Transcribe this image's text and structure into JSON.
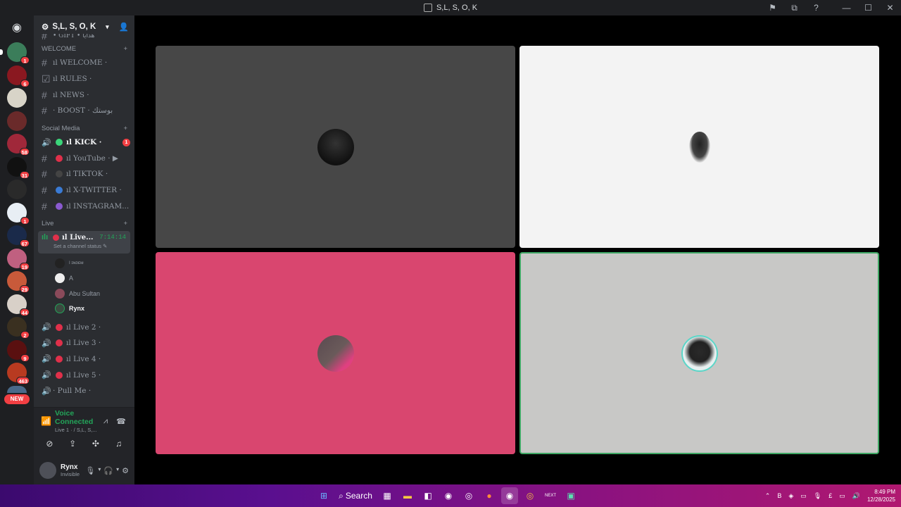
{
  "window": {
    "title": "S,L, S, O, K",
    "controls": [
      "⚑",
      "⧉",
      "?",
      "—",
      "☐",
      "✕"
    ]
  },
  "server": {
    "name": "S,L, S, O, K"
  },
  "rail": {
    "badges": [
      "1",
      "6",
      "",
      "",
      "58",
      "31",
      "",
      "1",
      "67",
      "19",
      "29",
      "44",
      "2",
      "9",
      "463"
    ],
    "new_label": "NEW"
  },
  "categories": {
    "welcome": "WELCOME",
    "social": "Social Media",
    "live": "Live"
  },
  "channels": {
    "gift": "• GIFT • هدايا",
    "welcome": "ıl WELCOME ·",
    "rules": "ıl RULES ·",
    "news": "ıl NEWS ·",
    "boost": "· BOOST · بوستك",
    "kick": "ıl KICK ·",
    "kick_count": "1",
    "youtube": "ıl YouTube · ▶",
    "tiktok": "ıl TIKTOK ·",
    "xtwitter": "ıl X-TWITTER ·",
    "instagram": "ıl INSTAGRAM...",
    "live1": "ıl Live...",
    "live1_timer": "7:14:14",
    "live1_status": "Set a channel status ✎",
    "live2": "ıl Live 2 ·",
    "live3": "ıl Live 3 ·",
    "live4": "ıl Live 4 ·",
    "live5": "ıl Live 5 ·",
    "pullme": "· Pull Me ·"
  },
  "members": [
    "ǀ ɪɴᴅᴇᴍ",
    "A",
    "Abu Sultan",
    "Rynx"
  ],
  "voice": {
    "status": "Voice Connected",
    "location": "Live 1 · / S,L, S,..."
  },
  "user": {
    "name": "Rynx",
    "status": "Invisible"
  },
  "taskbar": {
    "search_label": "Search",
    "time": "8:49 PM",
    "date": "12/28/2025",
    "lang": "£"
  },
  "colors": {
    "accent_green": "#23a559",
    "danger_red": "#f23f43",
    "tile1": "#474747",
    "tile2": "#f3f3f3",
    "tile3": "#d9466f",
    "tile4": "#c8c8c6"
  }
}
